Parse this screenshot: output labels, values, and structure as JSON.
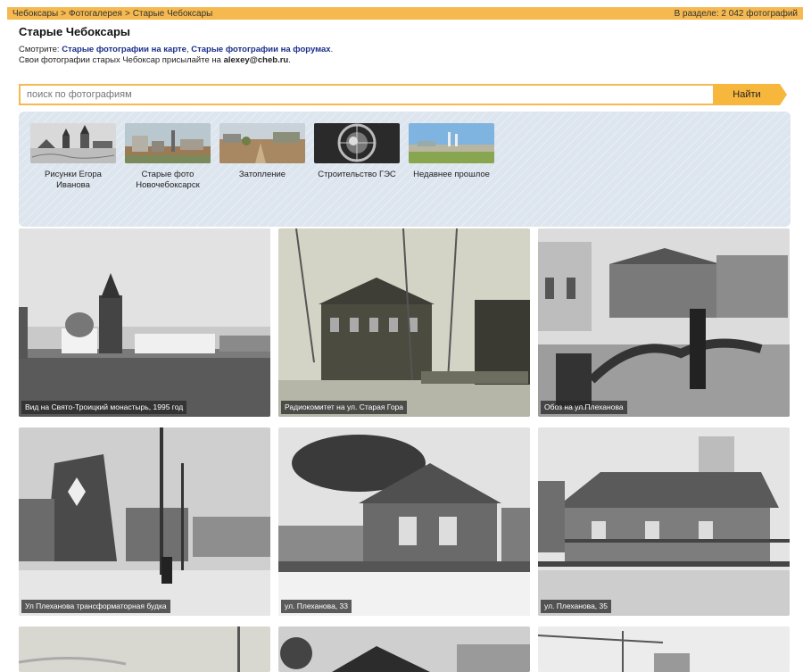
{
  "breadcrumb": {
    "items": [
      "Чебоксары",
      "Фотогалерея",
      "Старые Чебоксары"
    ],
    "separator": ">"
  },
  "section_count": "В разделе: 2 042 фотографий",
  "page_title": "Старые Чебоксары",
  "intro": {
    "line1_prefix": "Смотрите: ",
    "link_map": "Старые фотографии на карте",
    "comma": ", ",
    "link_forums": "Старые фотографии на форумах",
    "line1_suffix": ".",
    "line2_prefix": "Свои фотографии старых Чебоксар присылайте на ",
    "email": "alexey@cheb.ru",
    "line2_suffix": "."
  },
  "search": {
    "placeholder": "поиск по фотографиям",
    "button": "Найти"
  },
  "albums": [
    {
      "label": "Рисунки Егора Иванова"
    },
    {
      "label": "Старые фото Новочебоксарск"
    },
    {
      "label": "Затопление"
    },
    {
      "label": "Строительство ГЭС"
    },
    {
      "label": "Недавнее прошлое"
    }
  ],
  "photos": [
    {
      "caption": "Вид на Свято-Троицкий монастырь, 1995 год"
    },
    {
      "caption": "Радиокомитет на ул. Старая Гора"
    },
    {
      "caption": "Обоз на ул.Плеханова"
    },
    {
      "caption": "Ул Плеханова трансформаторная будка"
    },
    {
      "caption": "ул. Плеханова, 33"
    },
    {
      "caption": "ул. Плеханова, 35"
    },
    {
      "caption": ""
    },
    {
      "caption": ""
    },
    {
      "caption": ""
    }
  ]
}
